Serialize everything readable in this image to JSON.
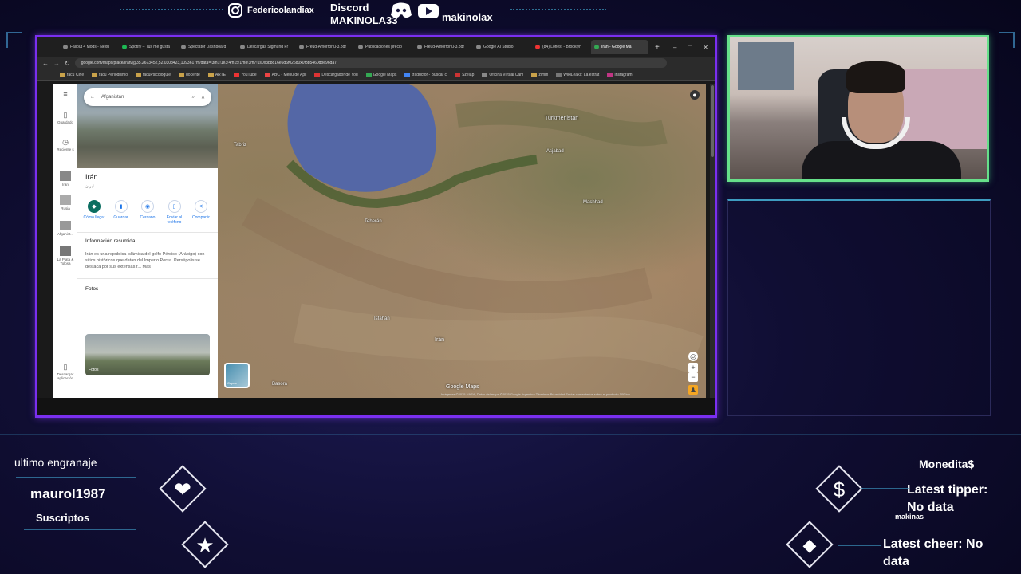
{
  "overlay": {
    "instagram_handle": "Federicolandiax",
    "discord_label": "Discord",
    "discord_handle": "MAKINOLA33",
    "youtube_handle": "makinolax",
    "left_widget": {
      "title": "ultimo engranaje",
      "user": "maurol1987",
      "subtitle": "Suscriptos"
    },
    "right_widget": {
      "title": "Monedita$",
      "tipper_label": "Latest tipper:",
      "tipper_value": "No data",
      "makinas_label": "makinas",
      "cheer_label": "Latest cheer: No",
      "cheer_value": "data"
    },
    "colors": {
      "browser_border": "#7a2ff0",
      "cam_border": "#66e08a",
      "accent_line": "#3b7fb0"
    }
  },
  "browser": {
    "tabs": [
      {
        "label": "Fallout 4 Mods - Nexu"
      },
      {
        "label": "Spotify – Tus me gusta"
      },
      {
        "label": "Spectator Dashboard"
      },
      {
        "label": "Descargas Sigmund Fr"
      },
      {
        "label": "Freud-Amorrortu-3.pdf"
      },
      {
        "label": "Publicaciones precio"
      },
      {
        "label": "Freud-Amorrortu-3.pdf"
      },
      {
        "label": "Google AI Studio"
      },
      {
        "label": "(84) Lofiest - Brooklyn"
      },
      {
        "label": "Irán - Google Ma"
      }
    ],
    "url": "google.com/maps/place/Irán/@35.2673452,52.0303423,1093617m/data=!3m1!1e3!4m15!1m8!3m7!1s0x3b8d16e6d6f026d0x0f3b5460dbe96da7",
    "bookmarks": [
      "facu Cine",
      "facu Periodismo",
      "facuPsicologuie",
      "docente",
      "ARTE",
      "YouTube",
      "ABC - Menú de Apli",
      "Descargador de You",
      "Google Maps",
      "traductor - Buscar c",
      "Szelap",
      "Oficina Virtual Cam",
      "zimm",
      "WikiLeaks: La estrat",
      "Instagram"
    ]
  },
  "maps": {
    "search_value": "Afganistán",
    "rail": [
      {
        "label": "Guardado",
        "icon": "bookmark-icon"
      },
      {
        "label": "Reciente s",
        "icon": "history-icon"
      },
      {
        "label": "Irán",
        "icon": "place-thumb-icon"
      },
      {
        "label": "Rusia",
        "icon": "place-thumb-icon"
      },
      {
        "label": "Afganist...",
        "icon": "place-thumb-icon"
      },
      {
        "label": "La Plata & Tolosa",
        "icon": "place-thumb-icon"
      },
      {
        "label": "Descargar aplicación",
        "icon": "phone-icon"
      }
    ],
    "place_title": "Irán",
    "place_subtitle": "ایران",
    "actions": [
      {
        "label": "Cómo llegar",
        "icon": "directions-icon"
      },
      {
        "label": "Guardar",
        "icon": "bookmark-icon"
      },
      {
        "label": "Cercano",
        "icon": "nearby-icon"
      },
      {
        "label": "Enviar al teléfono",
        "icon": "send-phone-icon"
      },
      {
        "label": "Compartir",
        "icon": "share-icon"
      }
    ],
    "summary_title": "Información resumida",
    "summary_text": "Irán es una república islámica del golfo Pérsico (Arábigo) con sitios históricos que datan del Imperio Persa. Persépolis se destaca por sus extensas r... Más",
    "photos_title": "Fotos",
    "photos_caption": "Fotos",
    "map_labels": [
      {
        "text": "Turkmenistán"
      },
      {
        "text": "Tabriz"
      },
      {
        "text": "Asjabad"
      },
      {
        "text": "Mashhad"
      },
      {
        "text": "Teherán"
      },
      {
        "text": "Isfahán"
      },
      {
        "text": "Irán"
      },
      {
        "text": "Basora"
      }
    ],
    "layers_label": "Capas",
    "logo_text": "Google Maps",
    "attribution": "Imágenes ©2025 NASA, Datos del mapa ©2025 Google   Argentina   Términos   Privacidad   Enviar comentarios sobre el producto   100 km"
  }
}
